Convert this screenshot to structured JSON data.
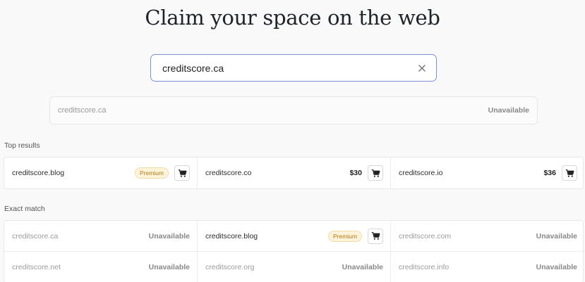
{
  "headline": "Claim your space on the web",
  "search": {
    "value": "creditscore.ca",
    "placeholder": ""
  },
  "query_result": {
    "domain": "creditscore.ca",
    "status": "Unavailable"
  },
  "top_results": {
    "label": "Top results",
    "items": [
      {
        "domain": "creditscore.blog",
        "badge": "Premium"
      },
      {
        "domain": "creditscore.co",
        "price": "$30"
      },
      {
        "domain": "creditscore.io",
        "price": "$36"
      }
    ]
  },
  "exact_match": {
    "label": "Exact match",
    "items": [
      {
        "domain": "creditscore.ca",
        "status": "Unavailable"
      },
      {
        "domain": "creditscore.blog",
        "badge": "Premium"
      },
      {
        "domain": "creditscore.com",
        "status": "Unavailable"
      },
      {
        "domain": "creditscore.net",
        "status": "Unavailable"
      },
      {
        "domain": "creditscore.org",
        "status": "Unavailable"
      },
      {
        "domain": "creditscore.info",
        "status": "Unavailable"
      }
    ]
  },
  "icons": {
    "clear": "close-icon",
    "cart": "cart-icon"
  },
  "colors": {
    "search_border": "#7a8fd8",
    "premium_bg": "#fff3d9",
    "premium_text": "#b07a18"
  }
}
